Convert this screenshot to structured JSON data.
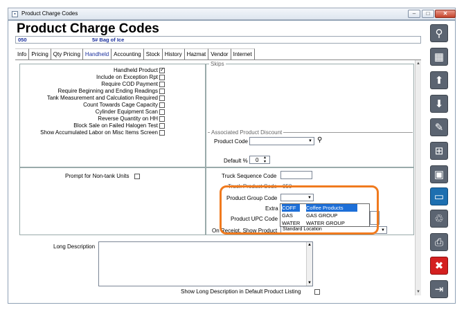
{
  "window": {
    "title": "Product Charge Codes"
  },
  "page_title": "Product Charge Codes",
  "product": {
    "code": "050",
    "description": "5# Bag of Ice"
  },
  "tabs": [
    "Info",
    "Pricing",
    "Qty Pricing",
    "Handheld",
    "Accounting",
    "Stock",
    "History",
    "Hazmat",
    "Vendor",
    "Internet"
  ],
  "active_tab": "Handheld",
  "handheld_options": [
    {
      "label": "Handheld Product",
      "checked": true
    },
    {
      "label": "Include on Exception Rpt",
      "checked": false
    },
    {
      "label": "Require COD Payment",
      "checked": false
    },
    {
      "label": "Require Beginning and Ending Readings",
      "checked": false
    },
    {
      "label": "Tank Measurement and Calculation Required",
      "checked": false
    },
    {
      "label": "Count Towards Cage Capacity",
      "checked": false
    },
    {
      "label": "Cylinder Equipment Scan",
      "checked": false
    },
    {
      "label": "Reverse Quantity on HH",
      "checked": false
    },
    {
      "label": "Block Sale on Failed Halogen Test",
      "checked": false
    },
    {
      "label": "Show Accumulated Labor on Misc Items Screen",
      "checked": false
    }
  ],
  "skips_legend": "Skips",
  "assoc": {
    "legend": "Associated Product Discount",
    "product_code_label": "Product Code",
    "default_pct_label": "Default %",
    "default_pct_value": "0"
  },
  "non_tank_label": "Prompt for Non-tank Units",
  "truck": {
    "sequence_label": "Truck Sequence Code",
    "product_code_label": "Truck Product Code",
    "product_code_value": "050",
    "group_code_label": "Product Group Code",
    "extra_label": "Extra",
    "upc_label": "Product UPC Code",
    "on_receipt_label": "On Receipt, Show Product",
    "on_receipt_value": "Standard Location"
  },
  "group_options": [
    {
      "code": "COFF",
      "name": "Coffee Products",
      "selected": true
    },
    {
      "code": "GAS",
      "name": "GAS GROUP",
      "selected": false
    },
    {
      "code": "WATER",
      "name": "WATER GROUP",
      "selected": false
    }
  ],
  "long_description_label": "Long Description",
  "show_long_desc_label": "Show Long Description in Default Product Listing",
  "colors": {
    "accent": "#1a2f9c",
    "highlight": "#f07a1e",
    "selection": "#1d6fd8"
  },
  "sidebar_icons": [
    "search-icon",
    "grid-icon",
    "arrow-up-icon",
    "arrow-down-icon",
    "edit-icon",
    "add-page-icon",
    "add-save-icon",
    "save-icon",
    "delete-icon",
    "print-icon",
    "close-icon",
    "exit-icon"
  ]
}
